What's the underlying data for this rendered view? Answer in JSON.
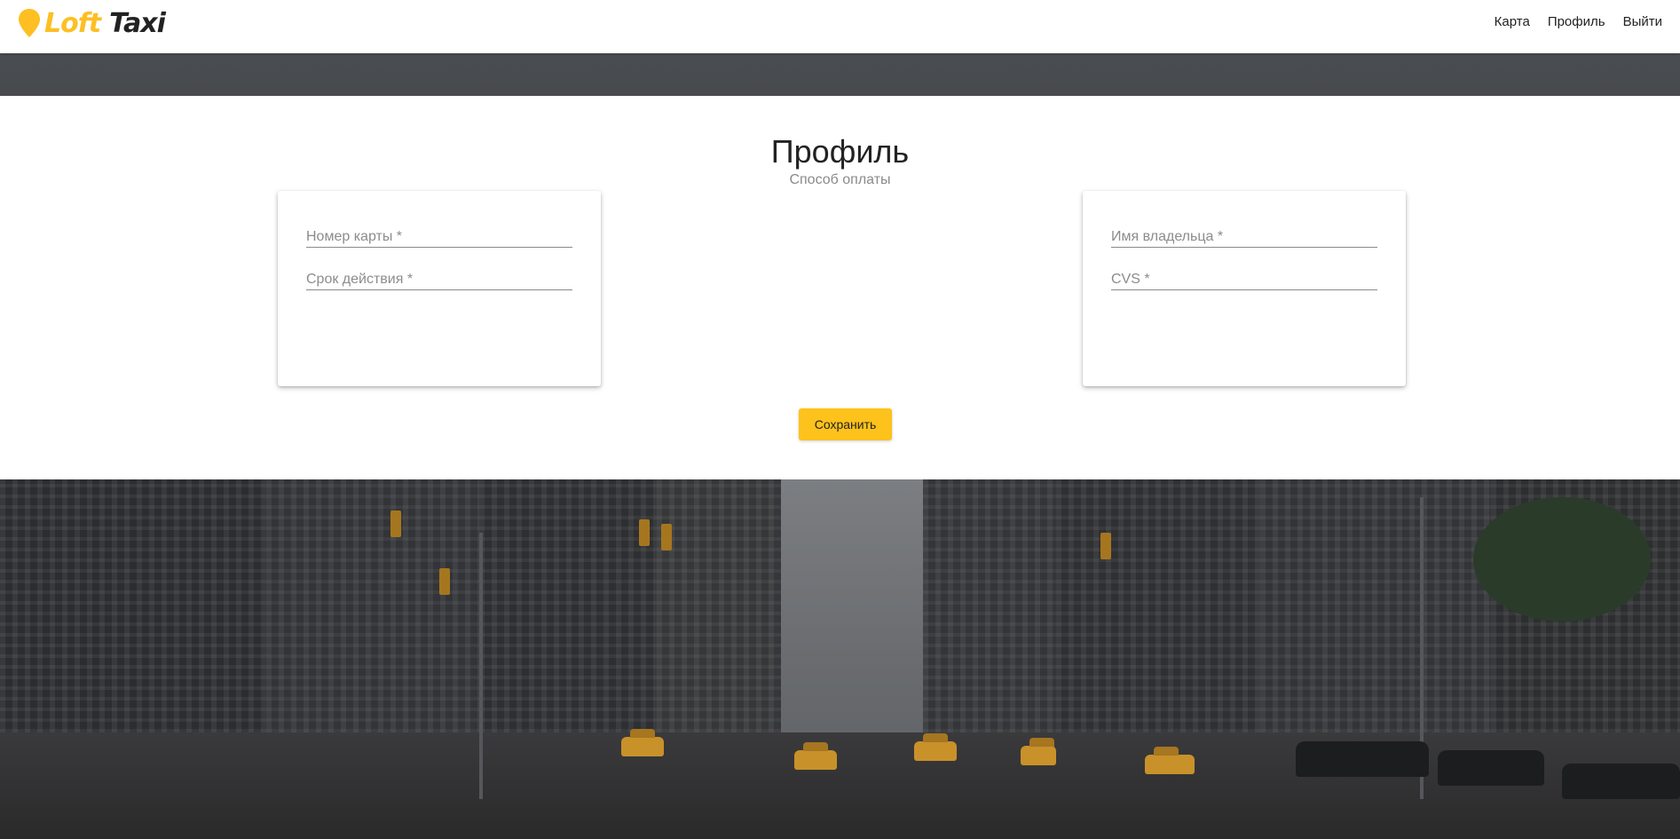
{
  "header": {
    "logo": {
      "part1": "Loft",
      "part2": "Taxi"
    },
    "nav": [
      {
        "label": "Карта"
      },
      {
        "label": "Профиль"
      },
      {
        "label": "Выйти"
      }
    ]
  },
  "profile": {
    "title": "Профиль",
    "subtitle": "Способ оплаты",
    "left_card": {
      "card_number_placeholder": "Номер карты *",
      "expiry_placeholder": "Срок действия *"
    },
    "right_card": {
      "owner_placeholder": "Имя владельца *",
      "cvs_placeholder": "CVS *"
    },
    "save_label": "Сохранить"
  },
  "colors": {
    "accent": "#fdc21b",
    "logo_yellow": "#fdbf22"
  },
  "icons": {
    "logo_icon": "map-pin-icon"
  }
}
